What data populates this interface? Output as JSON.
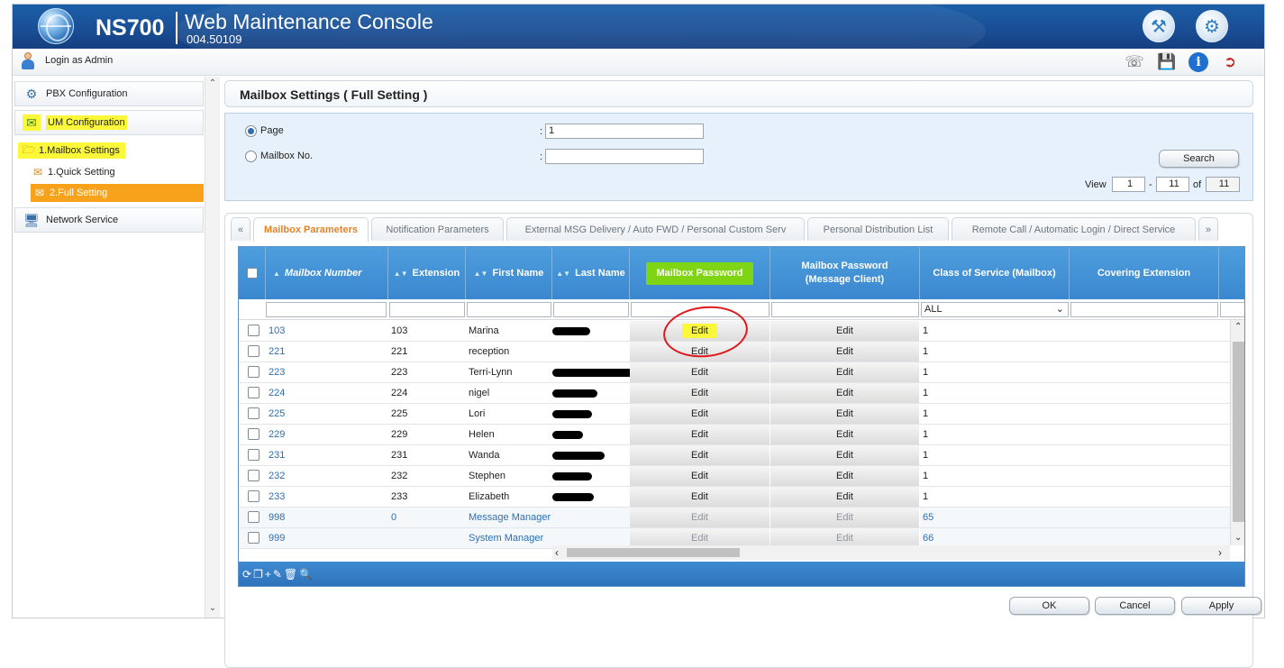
{
  "header": {
    "model": "NS700",
    "title": "Web Maintenance Console",
    "version": "004.50109"
  },
  "topbar": {
    "login_text": "Login as Admin"
  },
  "sidebar": {
    "items": [
      {
        "label": "PBX Configuration",
        "icon": "pbx-config-icon"
      },
      {
        "label": "UM Configuration",
        "icon": "um-config-icon"
      },
      {
        "label": "1.Mailbox Settings",
        "icon": "folder-icon"
      },
      {
        "label": "1.Quick Setting",
        "icon": "mail-icon"
      },
      {
        "label": "2.Full Setting",
        "icon": "mail-icon"
      },
      {
        "label": "Network Service",
        "icon": "network-icon"
      }
    ]
  },
  "main": {
    "title": "Mailbox Settings ( Full Setting )",
    "search": {
      "page_label": "Page",
      "mailbox_label": "Mailbox No.",
      "colon": ":",
      "page_value": "1",
      "mailbox_value": "",
      "search_button": "Search",
      "view_label": "View",
      "view_from": "1",
      "dash": "-",
      "view_to": "11",
      "of_label": "of",
      "view_total": "11"
    },
    "tabs": {
      "prev": "«",
      "next": "»",
      "items": [
        "Mailbox Parameters",
        "Notification Parameters",
        "External MSG Delivery / Auto FWD / Personal Custom Serv",
        "Personal Distribution List",
        "Remote Call / Automatic Login / Direct Service"
      ]
    },
    "grid": {
      "columns": [
        "Mailbox Number",
        "Extension",
        "First Name",
        "Last Name",
        "Mailbox Password",
        "Mailbox Password (Message Client)",
        "Class of Service (Mailbox)",
        "Covering Extension"
      ],
      "cos_filter": "ALL",
      "rows": [
        {
          "mailbox": "103",
          "ext": "103",
          "first": "Marina",
          "pw": "Edit",
          "pw_mc": "Edit",
          "cos": "1"
        },
        {
          "mailbox": "221",
          "ext": "221",
          "first": "reception",
          "pw": "Edit",
          "pw_mc": "Edit",
          "cos": "1"
        },
        {
          "mailbox": "223",
          "ext": "223",
          "first": "Terri-Lynn",
          "pw": "Edit",
          "pw_mc": "Edit",
          "cos": "1"
        },
        {
          "mailbox": "224",
          "ext": "224",
          "first": "nigel",
          "pw": "Edit",
          "pw_mc": "Edit",
          "cos": "1"
        },
        {
          "mailbox": "225",
          "ext": "225",
          "first": "Lori",
          "pw": "Edit",
          "pw_mc": "Edit",
          "cos": "1"
        },
        {
          "mailbox": "229",
          "ext": "229",
          "first": "Helen",
          "pw": "Edit",
          "pw_mc": "Edit",
          "cos": "1"
        },
        {
          "mailbox": "231",
          "ext": "231",
          "first": "Wanda",
          "pw": "Edit",
          "pw_mc": "Edit",
          "cos": "1"
        },
        {
          "mailbox": "232",
          "ext": "232",
          "first": "Stephen",
          "pw": "Edit",
          "pw_mc": "Edit",
          "cos": "1"
        },
        {
          "mailbox": "233",
          "ext": "233",
          "first": "Elizabeth",
          "pw": "Edit",
          "pw_mc": "Edit",
          "cos": "1"
        },
        {
          "mailbox": "998",
          "ext": "0",
          "first": "Message Manager",
          "pw": "Edit",
          "pw_mc": "Edit",
          "cos": "65"
        },
        {
          "mailbox": "999",
          "ext": "",
          "first": "System Manager",
          "pw": "Edit",
          "pw_mc": "Edit",
          "cos": "66"
        }
      ]
    },
    "buttons": {
      "ok": "OK",
      "cancel": "Cancel",
      "apply": "Apply"
    }
  },
  "colors": {
    "header_blue": "#1a4f96",
    "grid_header_blue": "#4e9ede",
    "active_nav_orange": "#f8a21b",
    "active_tab_orange": "#e2832a",
    "highlight_yellow": "#fbf83a",
    "highlight_green": "#7fd414",
    "annotation_red": "#e0161b"
  }
}
